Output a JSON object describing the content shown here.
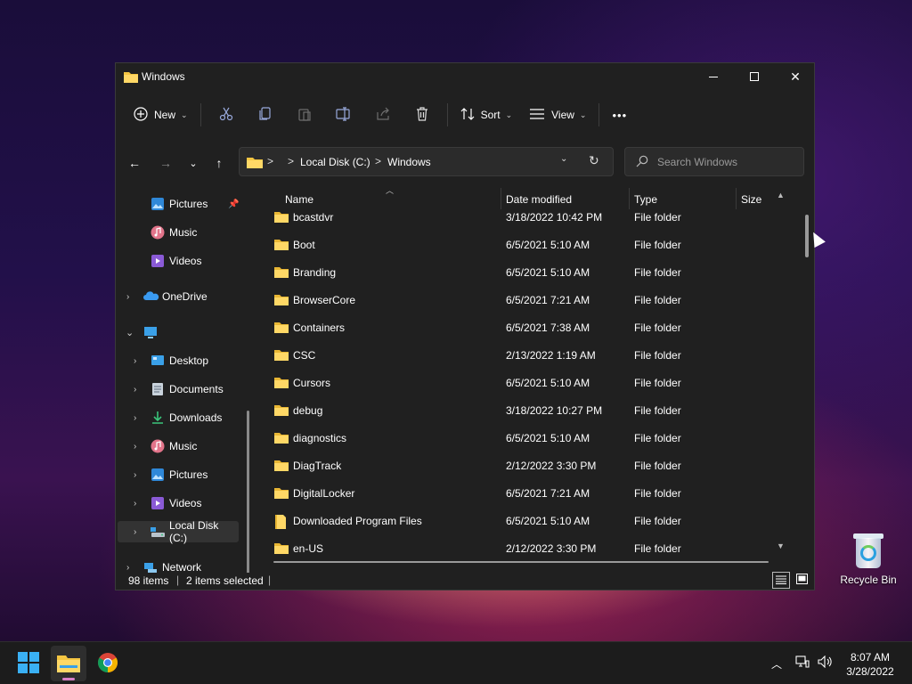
{
  "window": {
    "title": "Windows"
  },
  "toolbar": {
    "new_label": "New",
    "sort_label": "Sort",
    "view_label": "View",
    "more_label": "•••"
  },
  "address": {
    "sep": ">",
    "crumbs": [
      "Local Disk (C:)",
      "Windows"
    ]
  },
  "search": {
    "placeholder": "Search Windows"
  },
  "sidebar": {
    "items": [
      {
        "label": "Pictures",
        "icon": "pictures-icon"
      },
      {
        "label": "Music",
        "icon": "music-icon"
      },
      {
        "label": "Videos",
        "icon": "videos-icon"
      },
      {
        "label": "OneDrive",
        "icon": "onedrive-icon"
      },
      {
        "label": "",
        "icon": "this-pc-icon"
      },
      {
        "label": "Desktop",
        "icon": "desktop-icon"
      },
      {
        "label": "Documents",
        "icon": "documents-icon"
      },
      {
        "label": "Downloads",
        "icon": "downloads-icon"
      },
      {
        "label": "Music",
        "icon": "music-icon"
      },
      {
        "label": "Pictures",
        "icon": "pictures-icon"
      },
      {
        "label": "Videos",
        "icon": "videos-icon"
      },
      {
        "label": "Local Disk (C:)",
        "icon": "drive-icon"
      },
      {
        "label": "Network",
        "icon": "network-icon"
      }
    ]
  },
  "columns": {
    "name": "Name",
    "date": "Date modified",
    "type": "Type",
    "size": "Size"
  },
  "files": [
    {
      "name": "bcastdvr",
      "date": "3/18/2022 10:42 PM",
      "type": "File folder"
    },
    {
      "name": "Boot",
      "date": "6/5/2021 5:10 AM",
      "type": "File folder"
    },
    {
      "name": "Branding",
      "date": "6/5/2021 5:10 AM",
      "type": "File folder"
    },
    {
      "name": "BrowserCore",
      "date": "6/5/2021 7:21 AM",
      "type": "File folder"
    },
    {
      "name": "Containers",
      "date": "6/5/2021 7:38 AM",
      "type": "File folder"
    },
    {
      "name": "CSC",
      "date": "2/13/2022 1:19 AM",
      "type": "File folder"
    },
    {
      "name": "Cursors",
      "date": "6/5/2021 5:10 AM",
      "type": "File folder"
    },
    {
      "name": "debug",
      "date": "3/18/2022 10:27 PM",
      "type": "File folder"
    },
    {
      "name": "diagnostics",
      "date": "6/5/2021 5:10 AM",
      "type": "File folder"
    },
    {
      "name": "DiagTrack",
      "date": "2/12/2022 3:30 PM",
      "type": "File folder"
    },
    {
      "name": "DigitalLocker",
      "date": "6/5/2021 7:21 AM",
      "type": "File folder"
    },
    {
      "name": "Downloaded Program Files",
      "date": "6/5/2021 5:10 AM",
      "type": "File folder"
    },
    {
      "name": "en-US",
      "date": "2/12/2022 3:30 PM",
      "type": "File folder"
    }
  ],
  "status": {
    "count": "98 items",
    "selected": "2 items selected",
    "sep": "|"
  },
  "desktop": {
    "recycle_bin": "Recycle Bin"
  },
  "taskbar": {
    "time": "8:07 AM",
    "date": "3/28/2022"
  },
  "colors": {
    "window_bg": "#202020",
    "folder_yellow": "#f4c542",
    "accent_blue": "#3aa0e8"
  }
}
